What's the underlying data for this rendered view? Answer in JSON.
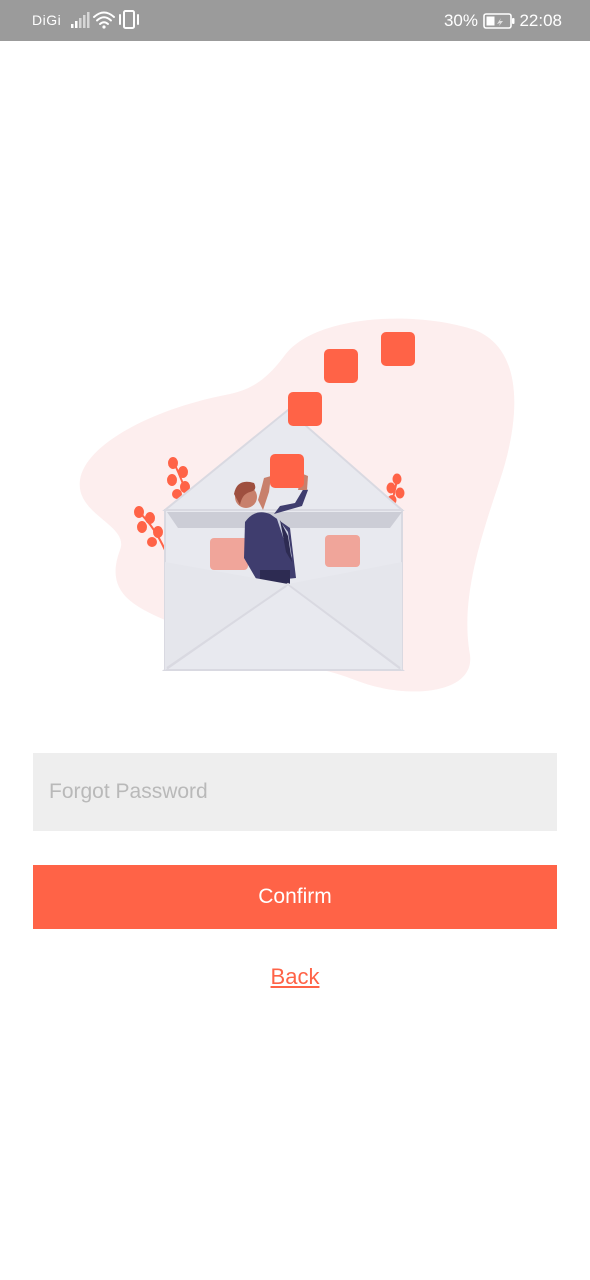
{
  "status_bar": {
    "carrier": "DiGi",
    "battery": "30%",
    "time": "22:08",
    "icons": [
      "signal-icon",
      "wifi-icon",
      "vibrate-icon",
      "battery-icon"
    ]
  },
  "illustration": {
    "icon": "mail-envelope-illustration"
  },
  "form": {
    "email_placeholder": "Forgot Password",
    "email_value": "",
    "confirm_label": "Confirm",
    "back_label": "Back"
  },
  "colors": {
    "accent": "#ff6347",
    "status_bar": "#9b9b9b",
    "input_bg": "#eeeeee",
    "blob": "#fdeeee"
  }
}
